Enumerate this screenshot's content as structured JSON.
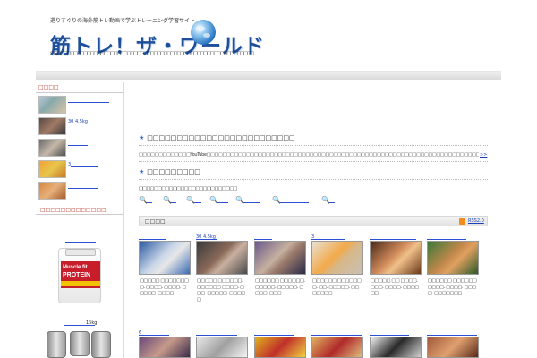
{
  "header": {
    "tagline": "選りすぐりの海外筋トレ動画で学ぶトレーニング学習サイト",
    "title": "筋トレ！ザ・ワールド",
    "description": "□□□□□□□□□□□□□□□□□□□□□□□□□□□□□□□□□□□□□□□□□□□□□□□□□□□□□□□□□□□□□"
  },
  "sidebar": {
    "heading": "□□□□",
    "items": [
      {
        "label": ""
      },
      {
        "label": "30  4.5kg"
      },
      {
        "label": ""
      },
      {
        "label": "3"
      },
      {
        "label": ""
      }
    ],
    "heading2": "□□□□□□□□□□□□□",
    "product1": {
      "brand": "weider",
      "name1": "Muscle fit",
      "name2": "PROTEIN"
    },
    "product2": {
      "label": "15kg"
    }
  },
  "main": {
    "section1_title": "□□□□□□□□□□□□□□□□□□□□□□□□□",
    "intro": "□□□□□□□□□□□□□YouTube□□□□□□□□□□□□□□□□□□□□□□□□□□□□□□□□□□□□□□□□□□□□□□□□□□□□□□□□□□□□□□□□□□□□□□□□□□□□□□□",
    "more": ">>",
    "section2_title": "□□□□□□□□□",
    "category_desc": "□□□□□□□□□□□□□□□□□□□□□□□□□□",
    "new_label": "□□□□",
    "rss_label": "RSS2.0",
    "cards_row1": [
      {
        "top_label": "",
        "caption": "□□□□□ □□□□□□□□. □□□□. □□□□. □□□□□. □□□□"
      },
      {
        "top_label": "30  4.5kg",
        "caption": "□□□□□ □□□□□□. □□□□□□ □□□□. □□□. □□□□□. □□□□□"
      },
      {
        "top_label": "",
        "caption": "□□□□□□ □□□□□□. □□□□□. □□□□□. □□□□. □□□"
      },
      {
        "top_label": "3",
        "caption": "□□□□□□ □□□□□□□. □□. □□□□□. □□□□□□□"
      },
      {
        "top_label": "",
        "caption": "□□□□□ □□ □□□□. □□□. □□□□. □□□□□□"
      },
      {
        "top_label": "",
        "caption": "□□□□□□ □□□□□□□□□□. □□□□. □□□□. □□□□□□□"
      }
    ],
    "cards_row2": [
      {
        "top_label": "6"
      },
      {
        "top_label": ""
      },
      {
        "top_label": ""
      },
      {
        "top_label": ""
      },
      {
        "top_label": ""
      },
      {
        "top_label": ""
      }
    ]
  },
  "colors": {
    "title_blue": "#1f4f9a",
    "link_blue": "#1a3fb8",
    "accent_red": "#c0392b",
    "star_blue": "#2b62c8",
    "rss_orange": "#f28c1b"
  }
}
